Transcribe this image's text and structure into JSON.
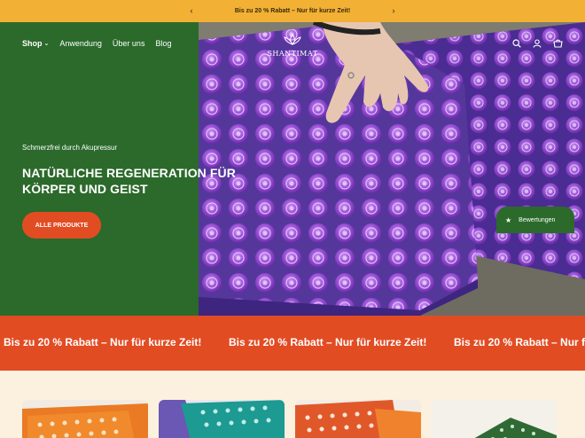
{
  "announcement": {
    "text": "Bis zu 20 % Rabatt – Nur für kurze Zeit!",
    "prev_icon": "chevron-left-icon",
    "next_icon": "chevron-right-icon"
  },
  "header": {
    "nav": [
      {
        "label": "Shop",
        "has_dropdown": true
      },
      {
        "label": "Anwendung"
      },
      {
        "label": "Über uns"
      },
      {
        "label": "Blog"
      }
    ],
    "logo_text": "SHANTIMAT",
    "icons": [
      "search-icon",
      "account-icon",
      "cart-icon"
    ]
  },
  "hero": {
    "kicker": "Schmerzfrei durch Akupressur",
    "headline_line1": "Natürliche Regeneration für",
    "headline_line2": "Körper und Geist",
    "cta": "ALLE PRODUKTE"
  },
  "reviews_tab": {
    "label": "Bewertungen"
  },
  "marquee": {
    "text": "Bis zu 20 % Rabatt – Nur für kurze Zeit!"
  },
  "colors": {
    "announcement_bg": "#f2b134",
    "hero_green": "#2b6a2b",
    "accent_orange": "#e24c23",
    "page_bg": "#fbf1de",
    "mat_purple": "#5a3ca0"
  }
}
